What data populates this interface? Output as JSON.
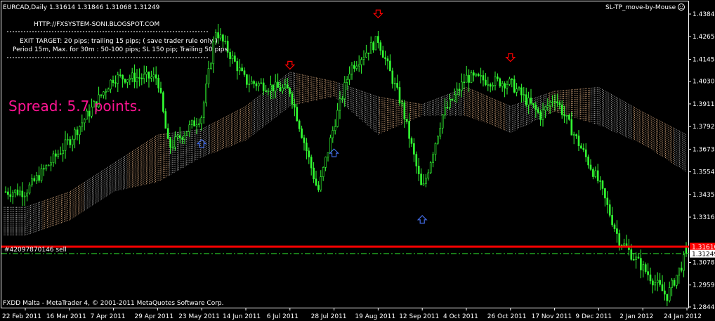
{
  "header": {
    "symbol_info": "EURCAD,Daily  1.31614 1.31846 1.31068 1.31249",
    "expert_name": "SL-TP_move-by-Mouse",
    "expert_icon": "smiley-icon"
  },
  "info_panel": {
    "url": "HTTP://FXSYSTEM-SONI.BLOGSPOT.COM",
    "line1": "EXIT TARGET: 20 pips; trailing 15 pips; ( save trader rule only )",
    "line2": "Period 15m, Max. for 30m  : 50-100 pips; SL 150 pip; Trailing 50 pips"
  },
  "spread_text": "Spread: 5.7 points.",
  "order_label": "#42097870146 sell",
  "footer": "FXDD Malta - MetaTrader 4, © 2001-2011 MetaQuotes Software Corp.",
  "colors": {
    "background": "#000000",
    "candle": "#33ff33",
    "cloud_a": "#ffc896",
    "cloud_b": "#c8c8c8",
    "support_line": "#ff0000",
    "price_tag_bg": "#ff0000",
    "spread_text": "#ff1493",
    "arrow_down": "#ff0000",
    "arrow_up": "#4169e1",
    "text": "#ffffff"
  },
  "price_axis": {
    "labels": [
      "1.43840",
      "1.42650",
      "1.41455",
      "1.40305",
      "1.39115",
      "1.37925",
      "1.36735",
      "1.35545",
      "1.34355",
      "1.33165",
      "1.30785",
      "1.29595",
      "1.28440"
    ],
    "red_line_tag": "1.31610",
    "current_price_tag": "1.31249"
  },
  "date_axis": {
    "labels": [
      "22 Feb 2011",
      "16 Mar 2011",
      "7 Apr 2011",
      "29 Apr 2011",
      "23 May 2011",
      "14 Jun 2011",
      "6 Jul 2011",
      "28 Jul 2011",
      "19 Aug 2011",
      "12 Sep 2011",
      "4 Oct 2011",
      "26 Oct 2011",
      "17 Nov 2011",
      "9 Dec 2011",
      "2 Jan 2012",
      "24 Jan 2012"
    ]
  },
  "chart_data": {
    "type": "candlestick",
    "symbol": "EURCAD",
    "timeframe": "Daily",
    "last_bar": {
      "open": 1.31614,
      "high": 1.31846,
      "low": 1.31068,
      "close": 1.31249
    },
    "ylim": [
      1.2844,
      1.4384
    ],
    "red_line_level": 1.3161,
    "order_level": 1.3124,
    "close_path": [
      {
        "date": "22 Feb 2011",
        "close": 1.345
      },
      {
        "date": "16 Mar 2011",
        "close": 1.372
      },
      {
        "date": "7 Apr 2011",
        "close": 1.405
      },
      {
        "date": "29 Apr 2011",
        "close": 1.405
      },
      {
        "date": "5 May 2011",
        "close": 1.368
      },
      {
        "date": "23 May 2011",
        "close": 1.385
      },
      {
        "date": "30 May 2011",
        "close": 1.43
      },
      {
        "date": "14 Jun 2011",
        "close": 1.403
      },
      {
        "date": "6 Jul 2011",
        "close": 1.398
      },
      {
        "date": "20 Jul 2011",
        "close": 1.345
      },
      {
        "date": "28 Jul 2011",
        "close": 1.38
      },
      {
        "date": "5 Aug 2011",
        "close": 1.41
      },
      {
        "date": "19 Aug 2011",
        "close": 1.425
      },
      {
        "date": "1 Sep 2011",
        "close": 1.39
      },
      {
        "date": "12 Sep 2011",
        "close": 1.345
      },
      {
        "date": "22 Sep 2011",
        "close": 1.385
      },
      {
        "date": "4 Oct 2011",
        "close": 1.405
      },
      {
        "date": "26 Oct 2011",
        "close": 1.402
      },
      {
        "date": "10 Nov 2011",
        "close": 1.385
      },
      {
        "date": "17 Nov 2011",
        "close": 1.395
      },
      {
        "date": "9 Dec 2011",
        "close": 1.35
      },
      {
        "date": "20 Dec 2011",
        "close": 1.32
      },
      {
        "date": "2 Jan 2012",
        "close": 1.305
      },
      {
        "date": "14 Jan 2012",
        "close": 1.29
      },
      {
        "date": "24 Jan 2012",
        "close": 1.3125
      }
    ],
    "cloud_path": [
      {
        "date": "22 Feb 2011",
        "top": 1.337,
        "bottom": 1.322
      },
      {
        "date": "16 Mar 2011",
        "top": 1.345,
        "bottom": 1.33
      },
      {
        "date": "7 Apr 2011",
        "top": 1.36,
        "bottom": 1.345
      },
      {
        "date": "29 Apr 2011",
        "top": 1.375,
        "bottom": 1.35
      },
      {
        "date": "23 May 2011",
        "top": 1.378,
        "bottom": 1.363
      },
      {
        "date": "14 Jun 2011",
        "top": 1.39,
        "bottom": 1.372
      },
      {
        "date": "6 Jul 2011",
        "top": 1.408,
        "bottom": 1.39
      },
      {
        "date": "28 Jul 2011",
        "top": 1.403,
        "bottom": 1.395
      },
      {
        "date": "19 Aug 2011",
        "top": 1.395,
        "bottom": 1.375
      },
      {
        "date": "12 Sep 2011",
        "top": 1.391,
        "bottom": 1.385
      },
      {
        "date": "4 Oct 2011",
        "top": 1.4,
        "bottom": 1.385
      },
      {
        "date": "26 Oct 2011",
        "top": 1.39,
        "bottom": 1.376
      },
      {
        "date": "17 Nov 2011",
        "top": 1.398,
        "bottom": 1.387
      },
      {
        "date": "9 Dec 2011",
        "top": 1.4,
        "bottom": 1.38
      },
      {
        "date": "2 Jan 2012",
        "top": 1.387,
        "bottom": 1.37
      },
      {
        "date": "24 Jan 2012",
        "top": 1.375,
        "bottom": 1.355
      }
    ],
    "signal_arrows": [
      {
        "direction": "down",
        "date": "6 Jul 2011"
      },
      {
        "direction": "down",
        "date": "19 Aug 2011"
      },
      {
        "direction": "down",
        "date": "26 Oct 2011"
      },
      {
        "direction": "up",
        "date": "23 May 2011"
      },
      {
        "direction": "up",
        "date": "28 Jul 2011"
      },
      {
        "direction": "up",
        "date": "12 Sep 2011"
      }
    ]
  }
}
